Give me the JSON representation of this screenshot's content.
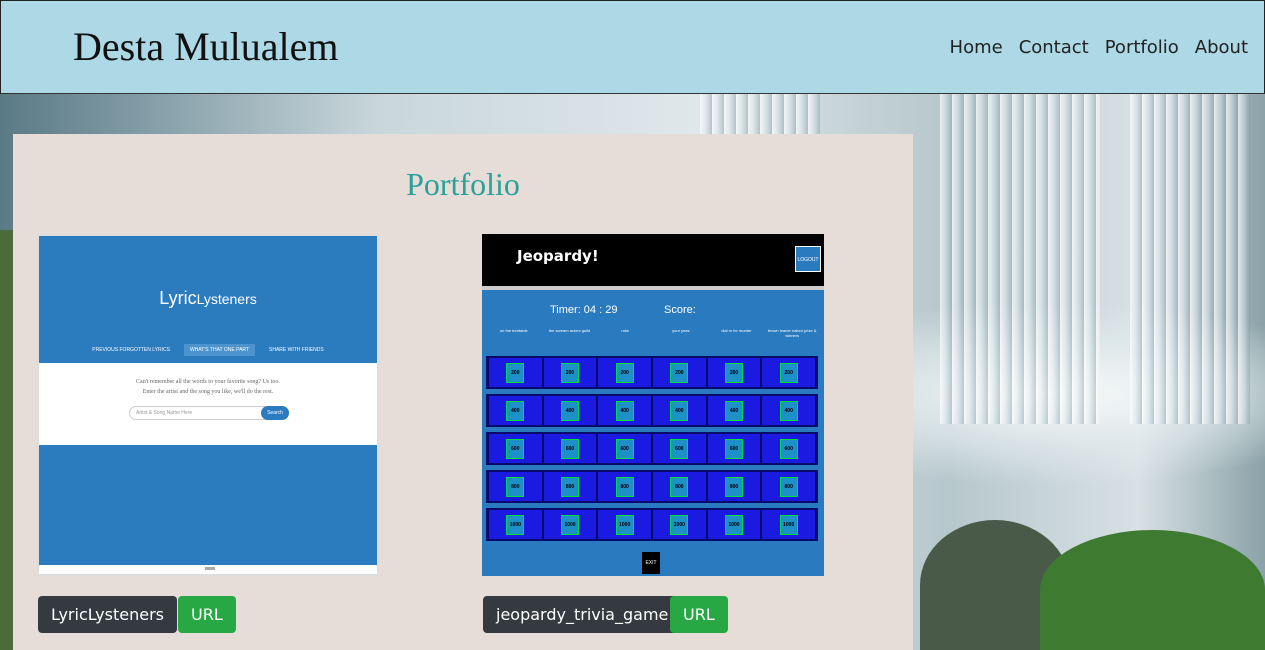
{
  "header": {
    "brand": "Desta Mulualem",
    "nav": [
      "Home",
      "Contact",
      "Portfolio",
      "About"
    ]
  },
  "panel": {
    "title": "Portfolio",
    "projects": [
      {
        "name": "LyricLysteners",
        "url_label": "URL",
        "thumbnail": {
          "logo_main": "Lyric",
          "logo_sub": "Lysteners",
          "tabs": [
            "PREVIOUS FORGOTTEN LYRICS",
            "WHAT'S THAT ONE PART",
            "SHARE WITH FRIENDS"
          ],
          "line1": "Can't remember all the words to your favorite song? Us too.",
          "line2": "Enter the artist and the song you like, we'll do the rest.",
          "search_placeholder": "Artist & Song Name Here",
          "search_button": "Search"
        }
      },
      {
        "name": "jeopardy_trivia_game",
        "url_label": "URL",
        "thumbnail": {
          "title": "Jeopardy!",
          "logout": "LOGOUT",
          "timer": "Timer: 04 : 29",
          "score": "Score:",
          "categories": [
            "on the turntable",
            "the scream actors guild",
            "rotw",
            "your yeas",
            "dial m for murder",
            "brown leaner naked prize & winners"
          ],
          "values": [
            "200",
            "400",
            "600",
            "800",
            "1000"
          ],
          "exit": "EXIT"
        }
      }
    ]
  },
  "colors": {
    "header_bg": "#add8e6",
    "panel_bg": "#e6dcd8",
    "title_color": "#2aa198",
    "dark_button": "#343a40",
    "green_button": "#28a745"
  }
}
